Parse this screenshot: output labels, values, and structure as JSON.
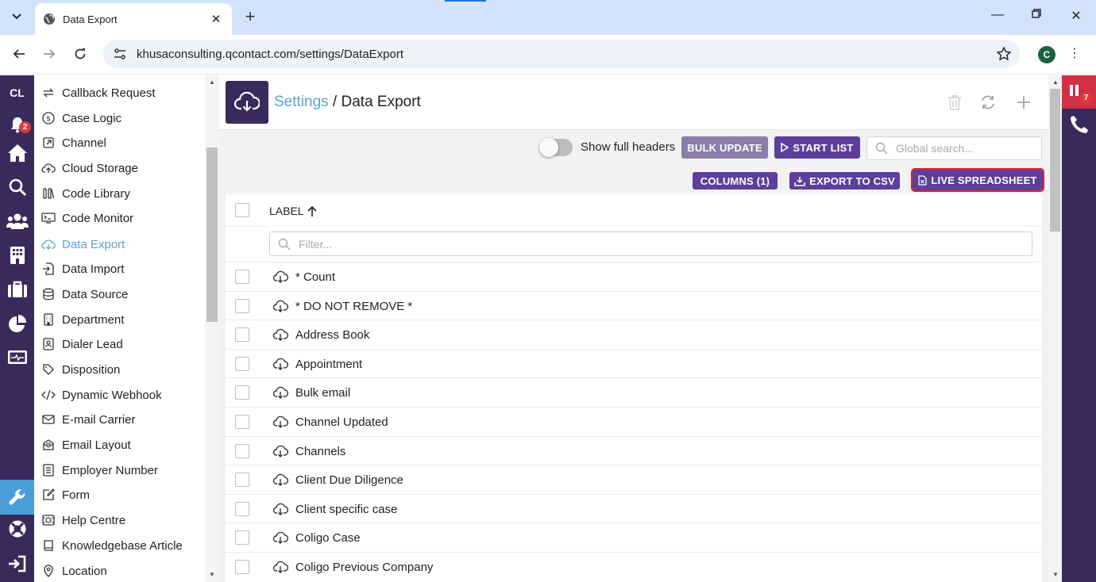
{
  "browser": {
    "tab_title": "Data Export",
    "url": "khusaconsulting.qcontact.com/settings/DataExport",
    "profile_initial": "C"
  },
  "rail": {
    "logo": "CL",
    "notification_count": "2",
    "icons": [
      "bell-icon",
      "home-icon",
      "search-icon",
      "contacts-icon",
      "building-icon",
      "briefcase-icon",
      "pie-chart-icon",
      "monitor-icon",
      "wrench-icon",
      "lifebuoy-icon",
      "logout-icon"
    ],
    "active": "wrench-icon"
  },
  "right_panel": {
    "badge_count": "7"
  },
  "submenu": {
    "items": [
      {
        "label": "Callback Request",
        "icon": "refresh-arrows-icon"
      },
      {
        "label": "Case Logic",
        "icon": "dollar-circle-icon"
      },
      {
        "label": "Channel",
        "icon": "external-link-icon"
      },
      {
        "label": "Cloud Storage",
        "icon": "cloud-upload-icon"
      },
      {
        "label": "Code Library",
        "icon": "books-icon"
      },
      {
        "label": "Code Monitor",
        "icon": "terminal-icon"
      },
      {
        "label": "Data Export",
        "icon": "cloud-download-icon",
        "active": true
      },
      {
        "label": "Data Import",
        "icon": "file-import-icon"
      },
      {
        "label": "Data Source",
        "icon": "database-icon"
      },
      {
        "label": "Department",
        "icon": "building-icon"
      },
      {
        "label": "Dialer Lead",
        "icon": "contact-card-icon"
      },
      {
        "label": "Disposition",
        "icon": "tag-icon"
      },
      {
        "label": "Dynamic Webhook",
        "icon": "code-icon"
      },
      {
        "label": "E-mail Carrier",
        "icon": "envelope-icon"
      },
      {
        "label": "Email Layout",
        "icon": "email-layout-icon"
      },
      {
        "label": "Employer Number",
        "icon": "list-icon"
      },
      {
        "label": "Form",
        "icon": "form-edit-icon"
      },
      {
        "label": "Help Centre",
        "icon": "help-centre-icon"
      },
      {
        "label": "Knowledgebase Article",
        "icon": "book-icon"
      },
      {
        "label": "Location",
        "icon": "location-pin-icon"
      }
    ]
  },
  "header": {
    "breadcrumb_link": "Settings",
    "breadcrumb_sep": " / ",
    "breadcrumb_current": "Data Export"
  },
  "toolbar": {
    "toggle_label": "Show full headers",
    "bulk_update": "BULK UPDATE",
    "start_list": "START LIST",
    "search_placeholder": "Global search...",
    "columns": "COLUMNS (1)",
    "export_csv": "EXPORT TO CSV",
    "live_spreadsheet": "LIVE SPREADSHEET"
  },
  "grid": {
    "column_label": "LABEL",
    "filter_placeholder": "Filter...",
    "rows": [
      "* Count",
      "* DO NOT REMOVE *",
      "Address Book",
      "Appointment",
      "Bulk email",
      "Channel Updated",
      "Channels",
      "Client Due Diligence",
      "Client specific case",
      "Coligo Case",
      "Coligo Previous Company"
    ]
  },
  "colors": {
    "brand_dark": "#3a2a5c",
    "button_purple": "#5d3f9a",
    "link_blue": "#5aa3d6",
    "highlight_red": "#e0202a"
  }
}
